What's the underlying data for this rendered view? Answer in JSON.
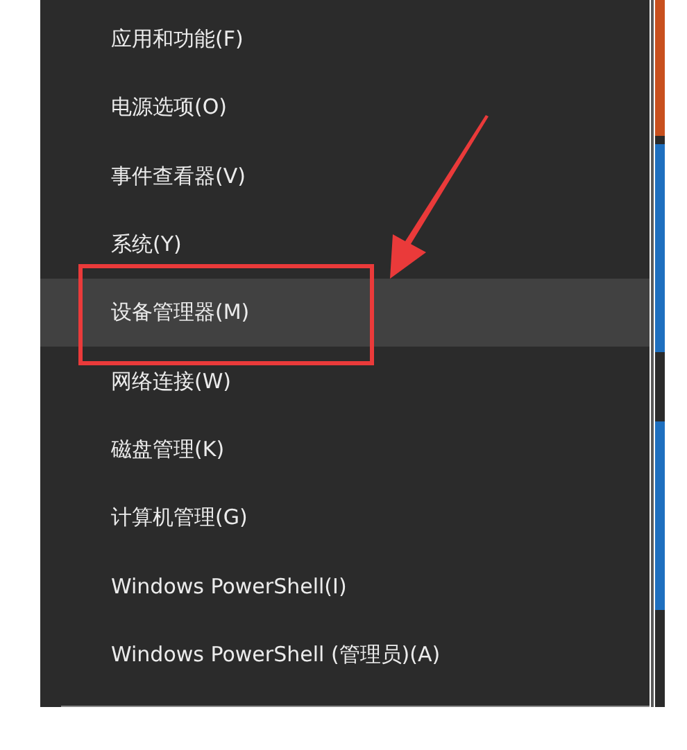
{
  "menu": {
    "items": [
      {
        "label": "应用和功能(F)",
        "selected": false
      },
      {
        "label": "电源选项(O)",
        "selected": false
      },
      {
        "label": "事件查看器(V)",
        "selected": false
      },
      {
        "label": "系统(Y)",
        "selected": false
      },
      {
        "label": "设备管理器(M)",
        "selected": true
      },
      {
        "label": "网络连接(W)",
        "selected": false
      },
      {
        "label": "磁盘管理(K)",
        "selected": false
      },
      {
        "label": "计算机管理(G)",
        "selected": false
      },
      {
        "label": "Windows PowerShell(I)",
        "selected": false
      },
      {
        "label": "Windows PowerShell (管理员)(A)",
        "selected": false
      }
    ]
  }
}
